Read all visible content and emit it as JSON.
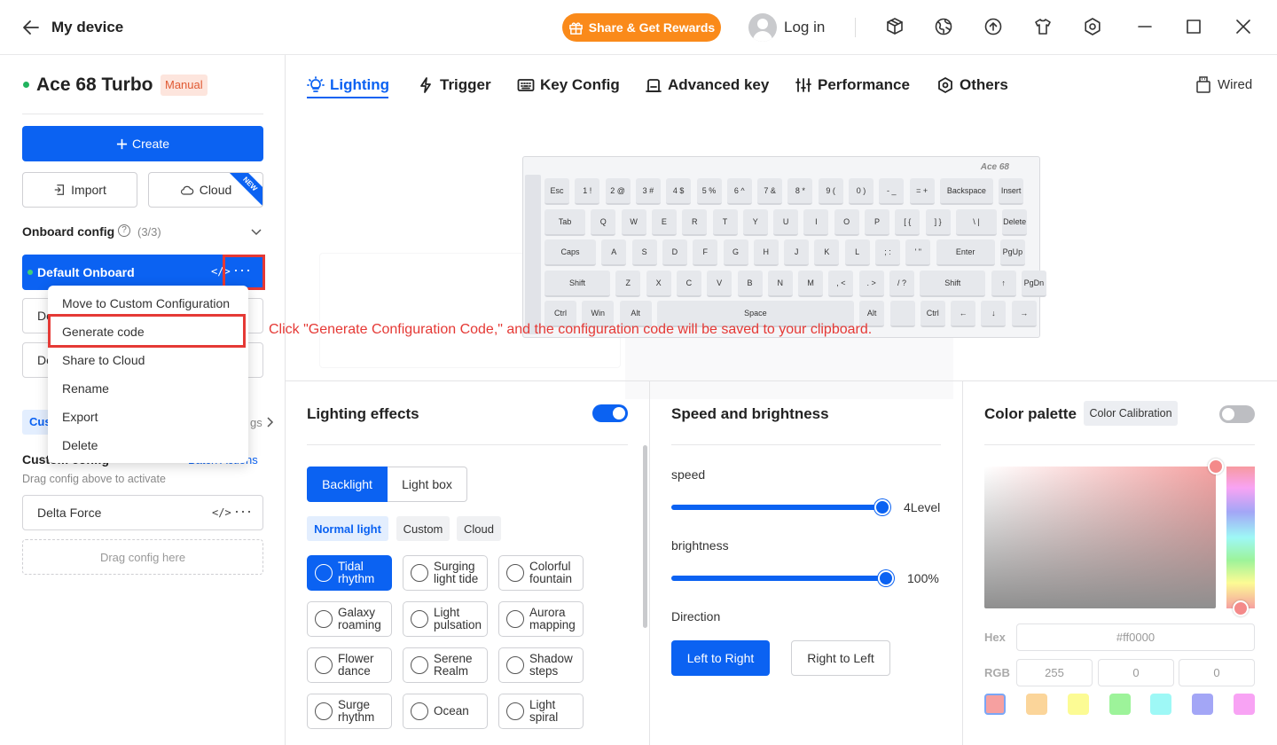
{
  "titlebar": {
    "back_title": "My device",
    "rewards_label": "Share & Get Rewards",
    "login_label": "Log in"
  },
  "sidebar": {
    "device_name": "Ace 68 Turbo",
    "device_badge": "Manual",
    "create_label": "Create",
    "import_label": "Import",
    "cloud_label": "Cloud",
    "new_badge": "NEW",
    "onboard_title": "Onboard config",
    "onboard_count": "(3/3)",
    "default_onboard": "Default Onboard",
    "row2_prefix": "De",
    "row3_prefix": "De",
    "custom_tab_partial": "Cus",
    "settings_partial": "gs",
    "custom_title": "Custom config",
    "batch_label": "Batch Actions",
    "drag_hint": "Drag config above to activate",
    "custom_item": "Delta Force",
    "drag_here": "Drag config here"
  },
  "context_menu": {
    "items": [
      "Move to Custom Configuration",
      "Generate code",
      "Share to Cloud",
      "Rename",
      "Export",
      "Delete"
    ]
  },
  "annotation": {
    "text": "Click \"Generate Configuration Code,\" and the configuration code will be saved to your clipboard."
  },
  "tabs": {
    "items": [
      "Lighting",
      "Trigger",
      "Key Config",
      "Advanced key",
      "Performance",
      "Others"
    ],
    "connection": "Wired"
  },
  "keyboard": {
    "brand": "Ace 68",
    "rows": [
      [
        "Esc",
        "1 !",
        "2 @",
        "3 #",
        "4 $",
        "5 %",
        "6 ^",
        "7 &",
        "8 *",
        "9 (",
        "0 )",
        "- _",
        "= +",
        "Backspace",
        "Insert"
      ],
      [
        "Tab",
        "Q",
        "W",
        "E",
        "R",
        "T",
        "Y",
        "U",
        "I",
        "O",
        "P",
        "[ {",
        "] }",
        "\\ |",
        "Delete"
      ],
      [
        "Caps",
        "A",
        "S",
        "D",
        "F",
        "G",
        "H",
        "J",
        "K",
        "L",
        "; :",
        "' \"",
        "Enter",
        "PgUp"
      ],
      [
        "Shift",
        "Z",
        "X",
        "C",
        "V",
        "B",
        "N",
        "M",
        ", <",
        ". >",
        "/ ?",
        "Shift",
        "↑",
        "PgDn"
      ],
      [
        "Ctrl",
        "Win",
        "Alt",
        "Space",
        "Alt",
        "",
        "Ctrl",
        "←",
        "↓",
        "→"
      ]
    ]
  },
  "lighting": {
    "title": "Lighting effects",
    "mode_tabs": [
      "Backlight",
      "Light box"
    ],
    "sub_tabs": [
      "Normal light",
      "Custom",
      "Cloud"
    ],
    "effects": [
      [
        "Tidal",
        "rhythm"
      ],
      [
        "Surging",
        "light tide"
      ],
      [
        "Colorful",
        "fountain"
      ],
      [
        "Galaxy",
        "roaming"
      ],
      [
        "Light",
        "pulsation"
      ],
      [
        "Aurora",
        "mapping"
      ],
      [
        "Flower",
        "dance"
      ],
      [
        "Serene",
        "Realm"
      ],
      [
        "Shadow",
        "steps"
      ],
      [
        "Surge",
        "rhythm"
      ],
      [
        "Ocean",
        ""
      ],
      [
        "Light",
        "spiral"
      ]
    ]
  },
  "speed_panel": {
    "title": "Speed and brightness",
    "speed_label": "speed",
    "speed_value": "4Level",
    "speed_fraction": 1.0,
    "brightness_label": "brightness",
    "brightness_value": "100%",
    "brightness_fraction": 1.0,
    "direction_label": "Direction",
    "dir_ltr": "Left to Right",
    "dir_rtl": "Right to Left"
  },
  "palette": {
    "title": "Color palette",
    "calibration": "Color Calibration",
    "hex_label": "Hex",
    "hex_value": "#ff0000",
    "rgb_label": "RGB",
    "r": "255",
    "g": "0",
    "b": "0",
    "swatches": [
      "#f6a0a0",
      "#fbd59a",
      "#fcfb94",
      "#9df39a",
      "#9ef8f6",
      "#a3a6f6",
      "#f8a3f4"
    ]
  },
  "colors": {
    "accent": "#0b62f2",
    "rewards": "#fa8a1a",
    "highlight_red": "#e53935"
  }
}
